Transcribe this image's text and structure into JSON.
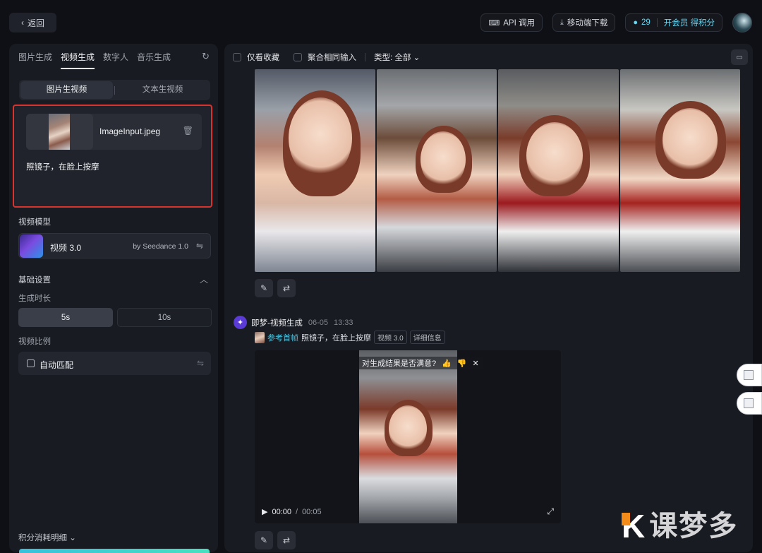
{
  "topbar": {
    "back_label": "返回",
    "api_label": "API 调用",
    "mobile_label": "移动端下载",
    "credits": "29",
    "vip_label": "开会员 得积分"
  },
  "left": {
    "tabs": [
      "图片生成",
      "视频生成",
      "数字人",
      "音乐生成"
    ],
    "subtabs": [
      "图片生视频",
      "文本生视频"
    ],
    "file_name": "ImageInput.jpeg",
    "prompt": "照镜子，在脸上按摩",
    "model_section": "视频模型",
    "model_name": "视频 3.0",
    "model_by": "by Seedance 1.0",
    "basic_settings": "基础设置",
    "duration_label": "生成时长",
    "duration_options": [
      "5s",
      "10s"
    ],
    "ratio_label": "视频比例",
    "ratio_value": "自动匹配",
    "credits_detail": "积分消耗明细"
  },
  "right": {
    "only_favorites": "仅看收藏",
    "aggregate": "聚合相同输入",
    "type_filter": "类型: 全部",
    "gen_title": "即梦-视频生成",
    "gen_date": "06-05",
    "gen_time": "13:33",
    "ref_label": "参考首帧",
    "ref_prompt": "照镜子，在脸上按摩",
    "tag_model": "视频 3.0",
    "tag_detail": "详细信息",
    "rating_question": "对生成结果是否满意?",
    "time_current": "00:00",
    "time_sep": "/",
    "time_total": "00:05"
  },
  "watermark": {
    "k": "K",
    "text": "课梦多"
  },
  "colors": {
    "accent": "#45c9e6",
    "highlight_border": "#d9332e",
    "watermark_orange": "#f28b1a"
  }
}
